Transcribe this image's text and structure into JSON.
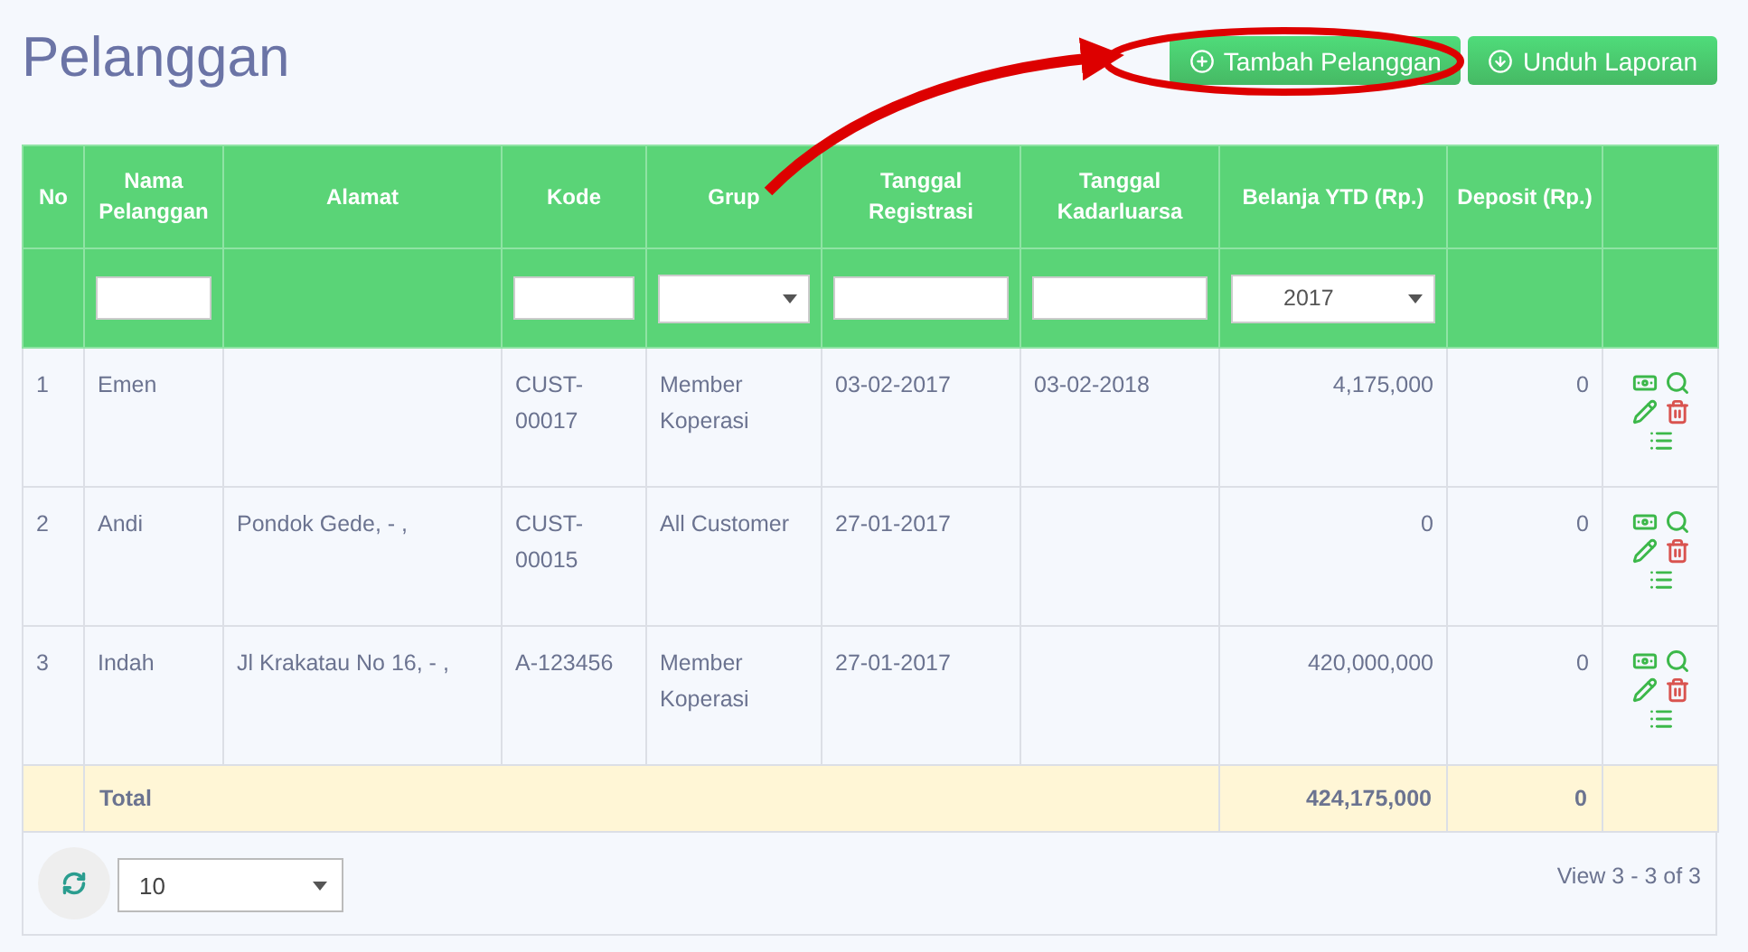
{
  "title": "Pelanggan",
  "buttons": [
    {
      "label": "Tambah Pelanggan",
      "kind": "add"
    },
    {
      "label": "Unduh Laporan",
      "kind": "download"
    }
  ],
  "table": {
    "columns": [
      "No",
      "Nama Pelanggan",
      "Alamat",
      "Kode",
      "Grup",
      "Tanggal Registrasi",
      "Tanggal Kadarluarsa",
      "Belanja YTD (Rp.)",
      "Deposit (Rp.)"
    ],
    "filters": [
      {
        "kind": "none"
      },
      {
        "kind": "text"
      },
      {
        "kind": "none"
      },
      {
        "kind": "text"
      },
      {
        "kind": "select"
      },
      {
        "kind": "text"
      },
      {
        "kind": "text"
      },
      {
        "kind": "select",
        "value": "2017"
      },
      {
        "kind": "none"
      }
    ],
    "rows": [
      {
        "no": "1",
        "nama": "Emen",
        "alamat": "",
        "kode": "CUST-00017",
        "grup": "Member Koperasi",
        "registrasi": "03-02-2017",
        "kadaluarsa": "03-02-2018",
        "belanja": "4,175,000",
        "deposit": "0"
      },
      {
        "no": "2",
        "nama": "Andi",
        "alamat": "Pondok Gede, - ,",
        "kode": "CUST-00015",
        "grup": "All Customer",
        "registrasi": "27-01-2017",
        "kadaluarsa": "",
        "belanja": "0",
        "deposit": "0"
      },
      {
        "no": "3",
        "nama": "Indah",
        "alamat": "Jl Krakatau No 16, - ,",
        "kode": "A-123456",
        "grup": "Member Koperasi",
        "registrasi": "27-01-2017",
        "kadaluarsa": "",
        "belanja": "420,000,000",
        "deposit": "0"
      }
    ],
    "total": {
      "label": "Total",
      "belanja": "424,175,000",
      "deposit": "0"
    }
  },
  "footer": {
    "page_size": "10",
    "info": "View 3 - 3 of 3"
  },
  "annotation": {
    "kind": "arrow_to_button"
  }
}
